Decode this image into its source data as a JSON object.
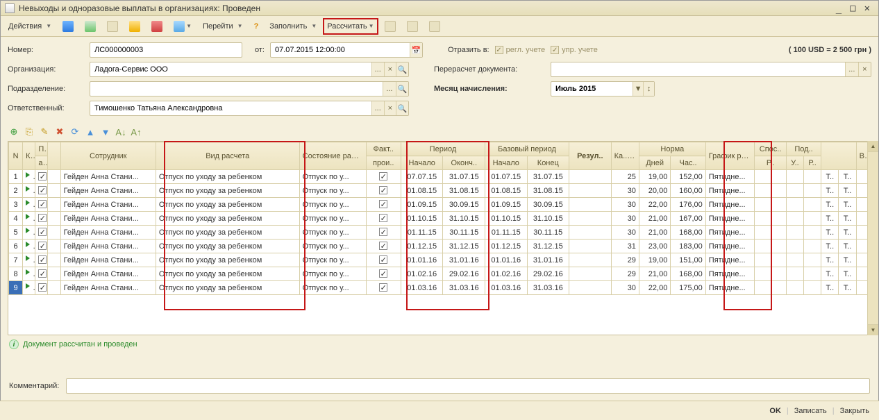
{
  "window": {
    "title": "Невыходы и одноразовые выплаты в организациях: Проведен"
  },
  "toolbar": {
    "actions": "Действия",
    "go": "Перейти",
    "fill": "Заполнить",
    "calc": "Рассчитать"
  },
  "form": {
    "number_label": "Номер:",
    "number_value": "ЛС000000003",
    "from_label": "от:",
    "from_value": "07.07.2015 12:00:00",
    "org_label": "Организация:",
    "org_value": "Ладога-Сервис ООО",
    "division_label": "Подразделение:",
    "division_value": "",
    "responsible_label": "Ответственный:",
    "responsible_value": "Тимошенко Татьяна Александровна",
    "reflect_label": "Отразить в:",
    "reflect_opt1": "регл. учете",
    "reflect_opt2": "упр. учете",
    "rate_info": "( 100 USD = 2 500 грн )",
    "recalc_label": "Перерасчет документа:",
    "recalc_value": "",
    "month_label": "Месяц начисления:",
    "month_value": "Июль 2015"
  },
  "grid": {
    "headers": {
      "n": "N",
      "k": "К..",
      "p": "П..",
      "pa": "а..",
      "employee": "Сотрудник",
      "calc_type": "Вид расчета",
      "worker_state": "Состояние работника",
      "fact": "Факт..",
      "fact2": "прои..",
      "period": "Период",
      "period_start": "Начало",
      "period_end": "Оконч..",
      "base_period": "Базовый период",
      "base_start": "Начало",
      "base_end": "Конец",
      "result": "Резул..",
      "cal_days": "Ка.. дни",
      "norm": "Норма",
      "norm_days": "Дней",
      "norm_hours": "Час..",
      "schedule": "График работы",
      "way": "Спос..",
      "division": "Под..",
      "r": "Р..",
      "u": "У..",
      "r2": "Р..",
      "u2": "У..",
      "v": "В.."
    },
    "rows": [
      {
        "n": "1",
        "employee": "Гейден Анна Стани...",
        "calc": "Отпуск по уходу за ребенком",
        "state": "Отпуск по у...",
        "ps": "07.07.15",
        "pe": "31.07.15",
        "bs": "01.07.15",
        "be": "31.07.15",
        "cd": "25",
        "nd": "19,00",
        "nh": "152,00",
        "sched": "Пятидне...",
        "r": "Т..",
        "u": "Т.."
      },
      {
        "n": "2",
        "employee": "Гейден Анна Стани...",
        "calc": "Отпуск по уходу за ребенком",
        "state": "Отпуск по у...",
        "ps": "01.08.15",
        "pe": "31.08.15",
        "bs": "01.08.15",
        "be": "31.08.15",
        "cd": "30",
        "nd": "20,00",
        "nh": "160,00",
        "sched": "Пятидне...",
        "r": "Т..",
        "u": "Т.."
      },
      {
        "n": "3",
        "employee": "Гейден Анна Стани...",
        "calc": "Отпуск по уходу за ребенком",
        "state": "Отпуск по у...",
        "ps": "01.09.15",
        "pe": "30.09.15",
        "bs": "01.09.15",
        "be": "30.09.15",
        "cd": "30",
        "nd": "22,00",
        "nh": "176,00",
        "sched": "Пятидне...",
        "r": "Т..",
        "u": "Т.."
      },
      {
        "n": "4",
        "employee": "Гейден Анна Стани...",
        "calc": "Отпуск по уходу за ребенком",
        "state": "Отпуск по у...",
        "ps": "01.10.15",
        "pe": "31.10.15",
        "bs": "01.10.15",
        "be": "31.10.15",
        "cd": "30",
        "nd": "21,00",
        "nh": "167,00",
        "sched": "Пятидне...",
        "r": "Т..",
        "u": "Т.."
      },
      {
        "n": "5",
        "employee": "Гейден Анна Стани...",
        "calc": "Отпуск по уходу за ребенком",
        "state": "Отпуск по у...",
        "ps": "01.11.15",
        "pe": "30.11.15",
        "bs": "01.11.15",
        "be": "30.11.15",
        "cd": "30",
        "nd": "21,00",
        "nh": "168,00",
        "sched": "Пятидне...",
        "r": "Т..",
        "u": "Т.."
      },
      {
        "n": "6",
        "employee": "Гейден Анна Стани...",
        "calc": "Отпуск по уходу за ребенком",
        "state": "Отпуск по у...",
        "ps": "01.12.15",
        "pe": "31.12.15",
        "bs": "01.12.15",
        "be": "31.12.15",
        "cd": "31",
        "nd": "23,00",
        "nh": "183,00",
        "sched": "Пятидне...",
        "r": "Т..",
        "u": "Т.."
      },
      {
        "n": "7",
        "employee": "Гейден Анна Стани...",
        "calc": "Отпуск по уходу за ребенком",
        "state": "Отпуск по у...",
        "ps": "01.01.16",
        "pe": "31.01.16",
        "bs": "01.01.16",
        "be": "31.01.16",
        "cd": "29",
        "nd": "19,00",
        "nh": "151,00",
        "sched": "Пятидне...",
        "r": "Т..",
        "u": "Т.."
      },
      {
        "n": "8",
        "employee": "Гейден Анна Стани...",
        "calc": "Отпуск по уходу за ребенком",
        "state": "Отпуск по у...",
        "ps": "01.02.16",
        "pe": "29.02.16",
        "bs": "01.02.16",
        "be": "29.02.16",
        "cd": "29",
        "nd": "21,00",
        "nh": "168,00",
        "sched": "Пятидне...",
        "r": "Т..",
        "u": "Т.."
      },
      {
        "n": "9",
        "employee": "Гейден Анна Стани...",
        "calc": "Отпуск по уходу за ребенком",
        "state": "Отпуск по у...",
        "ps": "01.03.16",
        "pe": "31.03.16",
        "bs": "01.03.16",
        "be": "31.03.16",
        "cd": "30",
        "nd": "22,00",
        "nh": "175,00",
        "sched": "Пятидне...",
        "r": "Т..",
        "u": "Т.."
      }
    ]
  },
  "status": {
    "text": "Документ рассчитан и проведен"
  },
  "comment": {
    "label": "Комментарий:",
    "value": ""
  },
  "footer": {
    "ok": "OK",
    "save": "Записать",
    "close": "Закрыть"
  }
}
